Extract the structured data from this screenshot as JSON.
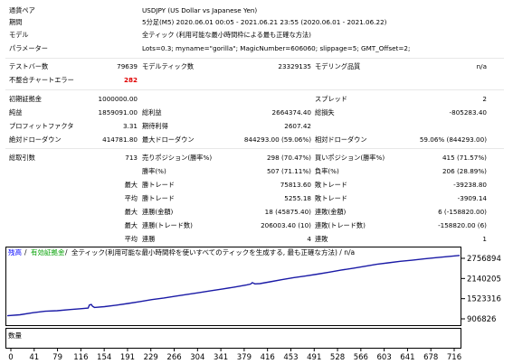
{
  "report": {
    "currency_pair": {
      "label": "通貨ペア",
      "value": "USDJPY (US Dollar vs Japanese Yen)"
    },
    "period": {
      "label": "期間",
      "value": "5分足(M5) 2020.06.01 00:05 - 2021.06.21 23:55 (2020.06.01 - 2021.06.22)"
    },
    "model": {
      "label": "モデル",
      "value": "全ティック (利用可能な最小時間枠による最も正確な方法)"
    },
    "parameters": {
      "label": "パラメーター",
      "value": "Lots=0.3; myname=\"gorilla\"; MagicNumber=606060; slippage=5; GMT_Offset=2;"
    },
    "bars_tested": {
      "label": "テストバー数",
      "value": "79639"
    },
    "model_ticks": {
      "label": "モデルティック数",
      "value": "23329135"
    },
    "modeling_quality": {
      "label": "モデリング品質",
      "value": "n/a"
    },
    "mismatched_chart_errors": {
      "label": "不整合チャートエラー",
      "value": "282"
    },
    "initial_deposit": {
      "label": "初期証拠金",
      "value": "1000000.00"
    },
    "spread": {
      "label": "スプレッド",
      "value": "2"
    },
    "net_profit": {
      "label": "純益",
      "value": "1859091.00"
    },
    "gross_profit": {
      "label": "総利益",
      "value": "2664374.40"
    },
    "gross_loss": {
      "label": "総損失",
      "value": "-805283.40"
    },
    "profit_factor": {
      "label": "プロフィットファクタ",
      "value": "3.31"
    },
    "expected_payoff": {
      "label": "期待利得",
      "value": "2607.42"
    },
    "abs_drawdown": {
      "label": "絶対ドローダウン",
      "value": "414781.80"
    },
    "max_drawdown": {
      "label": "最大ドローダウン",
      "value": "844293.00 (59.06%)"
    },
    "rel_drawdown": {
      "label": "相対ドローダウン",
      "value": "59.06% (844293.00)"
    },
    "total_trades": {
      "label": "総取引数",
      "value": "713"
    },
    "short_positions": {
      "label": "売りポジション(勝率%)",
      "value": "298 (70.47%)"
    },
    "long_positions": {
      "label": "買いポジション(勝率%)",
      "value": "415 (71.57%)"
    },
    "profit_trades": {
      "label": "勝率(%)",
      "value": "507 (71.11%)"
    },
    "loss_trades": {
      "label": "負率(%)",
      "value": "206 (28.89%)"
    },
    "largest_profit": {
      "prefix": "最大",
      "label": "勝トレード",
      "value": "75813.60"
    },
    "largest_loss": {
      "label": "敗トレード",
      "value": "-39238.80"
    },
    "avg_profit": {
      "prefix": "平均",
      "label": "勝トレード",
      "value": "5255.18"
    },
    "avg_loss": {
      "label": "敗トレード",
      "value": "-3909.14"
    },
    "max_consec_wins": {
      "prefix": "最大",
      "label": "連勝(金額)",
      "value": "18 (45875.40)"
    },
    "max_consec_losses": {
      "label": "連敗(金額)",
      "value": "6 (-158820.00)"
    },
    "max_consec_profit": {
      "prefix": "最大",
      "label": "連勝(トレード数)",
      "value": "206003.40 (10)"
    },
    "max_consec_loss": {
      "label": "連敗(トレード数)",
      "value": "-158820.00 (6)"
    },
    "avg_consec_wins": {
      "prefix": "平均",
      "label": "連勝",
      "value": "4"
    },
    "avg_consec_losses": {
      "label": "連敗",
      "value": "1"
    }
  },
  "chart_header": {
    "balance": "残高",
    "sep1": " / ",
    "equity": "有効証拠金",
    "sep2": " / ",
    "description": "全ティック(利用可能な最小時間枠を使いすべてのティックを生成する, 最も正確な方法) / n/a"
  },
  "volume_label": "数量",
  "colors": {
    "line": "#1a1aa6",
    "volume": "#16c216",
    "balance_label": "#0000ff",
    "equity_label": "#00a000"
  },
  "chart_data": {
    "type": "line",
    "y_ticks": [
      "2756894",
      "2140205",
      "1523316",
      "906826"
    ],
    "x_ticks": [
      "0",
      "41",
      "79",
      "116",
      "154",
      "191",
      "229",
      "266",
      "304",
      "341",
      "379",
      "416",
      "453",
      "491",
      "528",
      "566",
      "603",
      "641",
      "678",
      "716"
    ],
    "series": [
      {
        "x": [
          0,
          20,
          41,
          60,
          79,
          100,
          116,
          128,
          130,
          133,
          135,
          138,
          154,
          172,
          191,
          210,
          229,
          248,
          266,
          285,
          304,
          322,
          341,
          360,
          379,
          385,
          388,
          392,
          400,
          416,
          435,
          453,
          472,
          491,
          510,
          528,
          548,
          566,
          585,
          603,
          622,
          641,
          660,
          678,
          697,
          716
        ],
        "values": [
          1000000,
          1030000,
          1095000,
          1140000,
          1155000,
          1190000,
          1215000,
          1235000,
          1330000,
          1345000,
          1290000,
          1255000,
          1280000,
          1325000,
          1375000,
          1435000,
          1495000,
          1545000,
          1600000,
          1655000,
          1710000,
          1765000,
          1820000,
          1880000,
          1945000,
          1970000,
          2015000,
          1975000,
          1985000,
          2040000,
          2105000,
          2165000,
          2215000,
          2275000,
          2335000,
          2395000,
          2455000,
          2515000,
          2575000,
          2620000,
          2665000,
          2700000,
          2740000,
          2775000,
          2810000,
          2845000
        ]
      }
    ],
    "ylim": [
      906826,
      2756894
    ],
    "xlim": [
      0,
      716
    ]
  }
}
